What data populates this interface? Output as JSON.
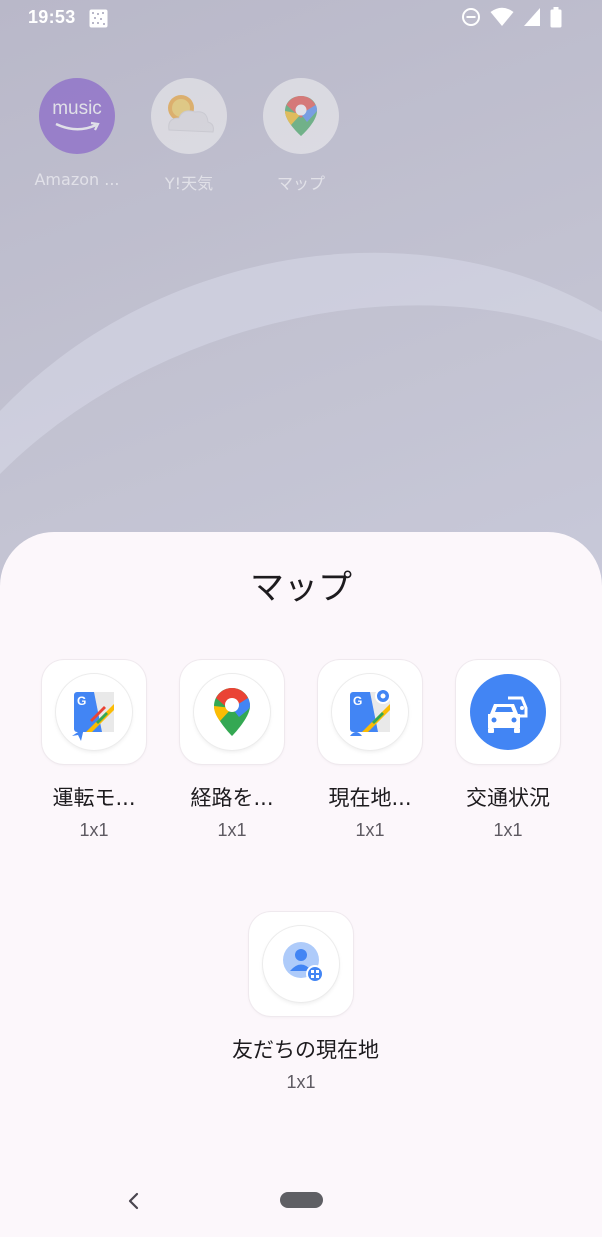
{
  "status_bar": {
    "time": "19:53",
    "icons": [
      "gallery-icon",
      "do-not-disturb-icon",
      "wifi-icon",
      "signal-icon",
      "battery-icon"
    ]
  },
  "home_screen": {
    "apps": [
      {
        "label": "Amazon ...",
        "icon": "amazon-music-icon",
        "icon_text": "music"
      },
      {
        "label": "Y!天気",
        "icon": "yahoo-weather-icon"
      },
      {
        "label": "マップ",
        "icon": "google-maps-icon"
      }
    ]
  },
  "sheet": {
    "title": "マップ",
    "widgets": [
      {
        "name": "運転モ...",
        "size": "1x1",
        "icon": "driving-mode-icon"
      },
      {
        "name": "経路を...",
        "size": "1x1",
        "icon": "maps-pin-icon"
      },
      {
        "name": "現在地...",
        "size": "1x1",
        "icon": "current-location-icon"
      },
      {
        "name": "交通状況",
        "size": "1x1",
        "icon": "traffic-car-icon"
      },
      {
        "name": "友だちの現在地",
        "size": "1x1",
        "icon": "friend-location-icon"
      }
    ]
  },
  "colors": {
    "sheet_background": "#fcf7fb",
    "google_blue": "#4285f4",
    "google_red": "#ea4335",
    "google_yellow": "#fbbc04",
    "google_green": "#34a853",
    "home_indicator": "#5f5f64"
  }
}
